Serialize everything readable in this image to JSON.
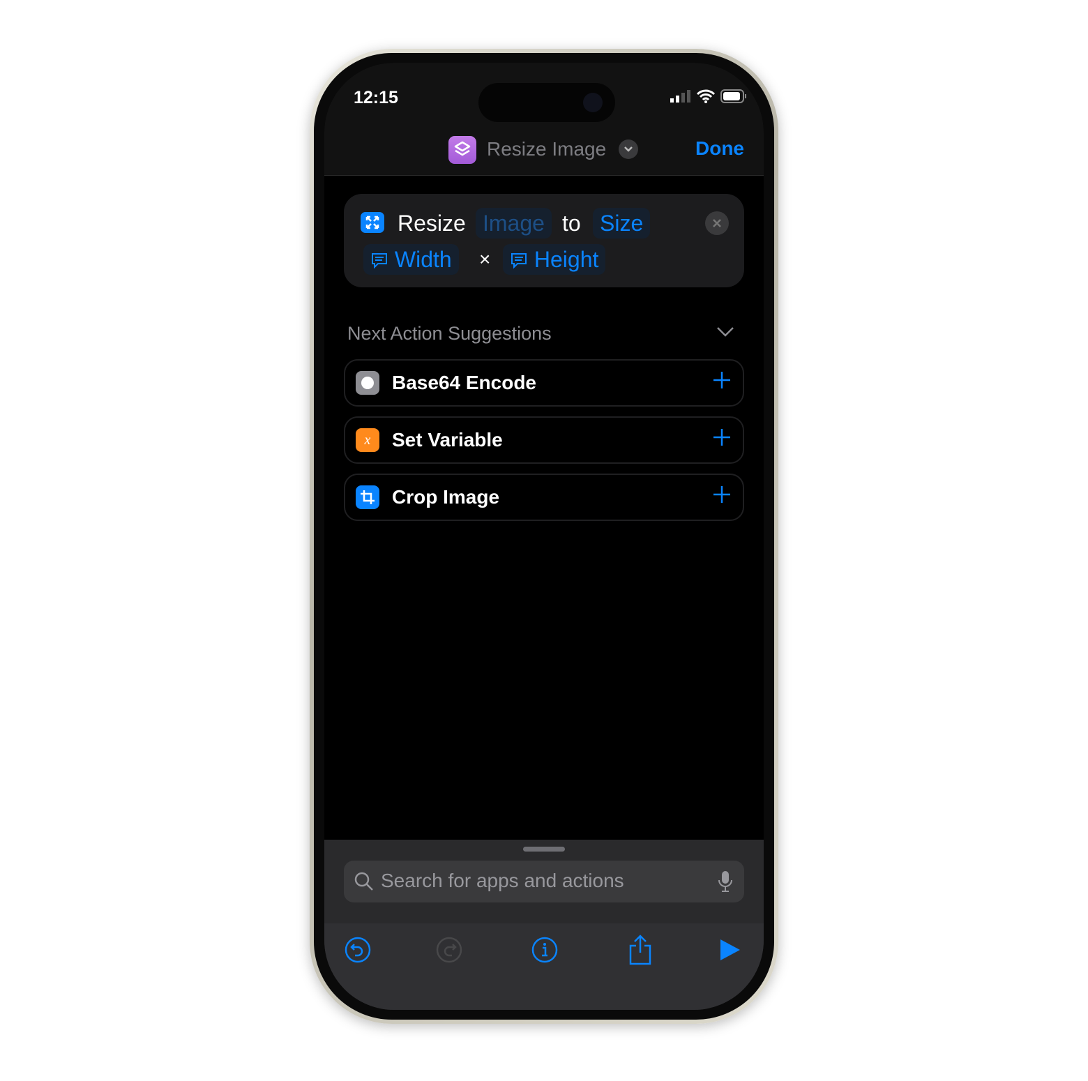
{
  "status_bar": {
    "time": "12:15"
  },
  "nav": {
    "title": "Resize Image",
    "done_label": "Done",
    "app_icon": "shortcuts-icon",
    "app_color": "#b36ae0"
  },
  "action": {
    "icon": "resize-arrows-icon",
    "verb": "Resize",
    "input": "Image",
    "joiner": "to",
    "mode": "Size",
    "width": "Width",
    "times": "×",
    "height": "Height"
  },
  "suggestions": {
    "title": "Next Action Suggestions",
    "items": [
      {
        "label": "Base64 Encode",
        "icon": "base64-icon",
        "color": "#8e8e93"
      },
      {
        "label": "Set Variable",
        "icon": "variable-icon",
        "color": "#ff8a1c"
      },
      {
        "label": "Crop Image",
        "icon": "crop-icon",
        "color": "#0a84ff"
      }
    ]
  },
  "search": {
    "placeholder": "Search for apps and actions"
  },
  "colors": {
    "accent": "#0a84ff",
    "disabled": "#48484a"
  }
}
